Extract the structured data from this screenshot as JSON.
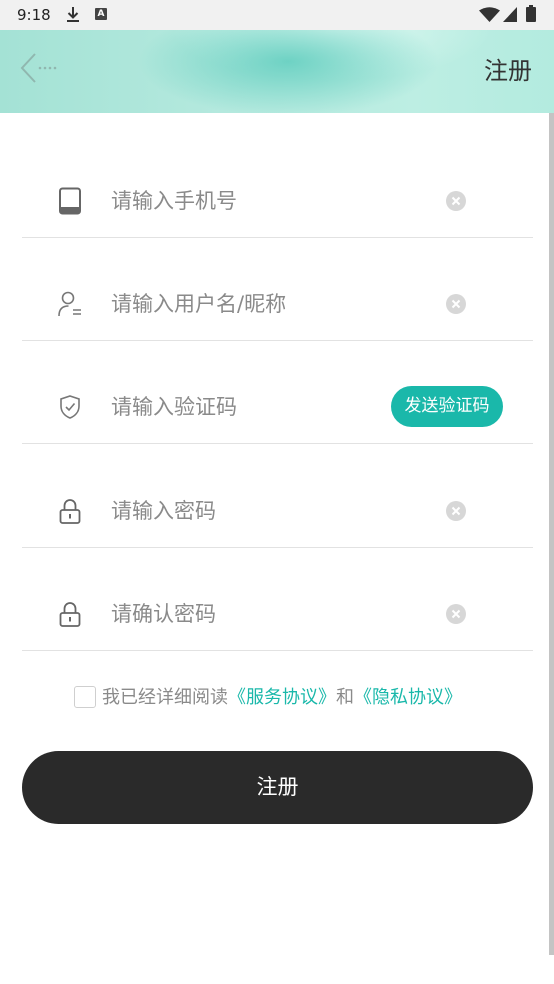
{
  "status_bar": {
    "time": "9:18",
    "app_badge": "A",
    "icons": [
      "download-icon",
      "app-badge-icon",
      "wifi-icon",
      "signal-icon",
      "battery-icon"
    ]
  },
  "header": {
    "back_icon": "back-arrow-icon",
    "title": "注册"
  },
  "fields": [
    {
      "icon": "phone-icon",
      "placeholder": "请输入手机号",
      "value": "",
      "action_icon": "clear-icon"
    },
    {
      "icon": "user-icon",
      "placeholder": "请输入用户名/昵称",
      "value": "",
      "action_icon": "clear-icon"
    },
    {
      "icon": "shield-check-icon",
      "placeholder": "请输入验证码",
      "value": "",
      "action_label": "发送验证码"
    },
    {
      "icon": "lock-icon",
      "placeholder": "请输入密码",
      "value": "",
      "action_icon": "clear-icon"
    },
    {
      "icon": "lock-icon",
      "placeholder": "请确认密码",
      "value": "",
      "action_icon": "clear-icon"
    }
  ],
  "agreement": {
    "checked": false,
    "prefix": "我已经详细阅读",
    "service_link": "《服务协议》",
    "conjunction": "和",
    "privacy_link": "《隐私协议》"
  },
  "submit": {
    "label": "注册"
  },
  "colors": {
    "accent": "#1ab8aa",
    "submit_bg": "#2a2a2a",
    "placeholder": "#8a8a8a",
    "divider": "#e2e2e2"
  }
}
